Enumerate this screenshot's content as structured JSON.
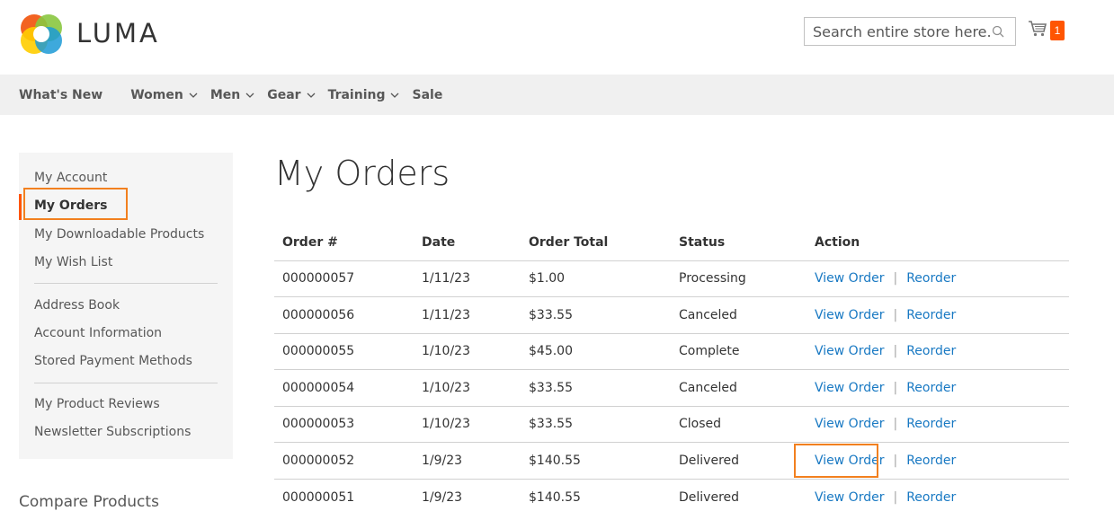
{
  "header": {
    "logo_text": "LUMA",
    "search_placeholder": "Search entire store here...",
    "cart_count": "1"
  },
  "nav": {
    "items": [
      {
        "label": "What's New",
        "has_dropdown": false
      },
      {
        "label": "Women",
        "has_dropdown": true
      },
      {
        "label": "Men",
        "has_dropdown": true
      },
      {
        "label": "Gear",
        "has_dropdown": true
      },
      {
        "label": "Training",
        "has_dropdown": true
      },
      {
        "label": "Sale",
        "has_dropdown": false
      }
    ]
  },
  "sidebar": {
    "items": [
      {
        "label": "My Account"
      },
      {
        "label": "My Orders",
        "active": true
      },
      {
        "label": "My Downloadable Products"
      },
      {
        "label": "My Wish List"
      },
      {
        "label": "Address Book"
      },
      {
        "label": "Account Information"
      },
      {
        "label": "Stored Payment Methods"
      },
      {
        "label": "My Product Reviews"
      },
      {
        "label": "Newsletter Subscriptions"
      }
    ],
    "compare_title": "Compare Products"
  },
  "main": {
    "title": "My Orders",
    "table": {
      "headers": [
        "Order #",
        "Date",
        "Order Total",
        "Status",
        "Action"
      ],
      "view_label": "View Order",
      "reorder_label": "Reorder",
      "separator": "|",
      "rows": [
        {
          "order": "000000057",
          "date": "1/11/23",
          "total": "$1.00",
          "status": "Processing"
        },
        {
          "order": "000000056",
          "date": "1/11/23",
          "total": "$33.55",
          "status": "Canceled"
        },
        {
          "order": "000000055",
          "date": "1/10/23",
          "total": "$45.00",
          "status": "Complete"
        },
        {
          "order": "000000054",
          "date": "1/10/23",
          "total": "$33.55",
          "status": "Canceled"
        },
        {
          "order": "000000053",
          "date": "1/10/23",
          "total": "$33.55",
          "status": "Closed"
        },
        {
          "order": "000000052",
          "date": "1/9/23",
          "total": "$140.55",
          "status": "Delivered"
        },
        {
          "order": "000000051",
          "date": "1/9/23",
          "total": "$140.55",
          "status": "Delivered"
        }
      ]
    }
  },
  "colors": {
    "accent": "#ff5501",
    "link": "#1979c3",
    "highlight": "#f2801f"
  }
}
